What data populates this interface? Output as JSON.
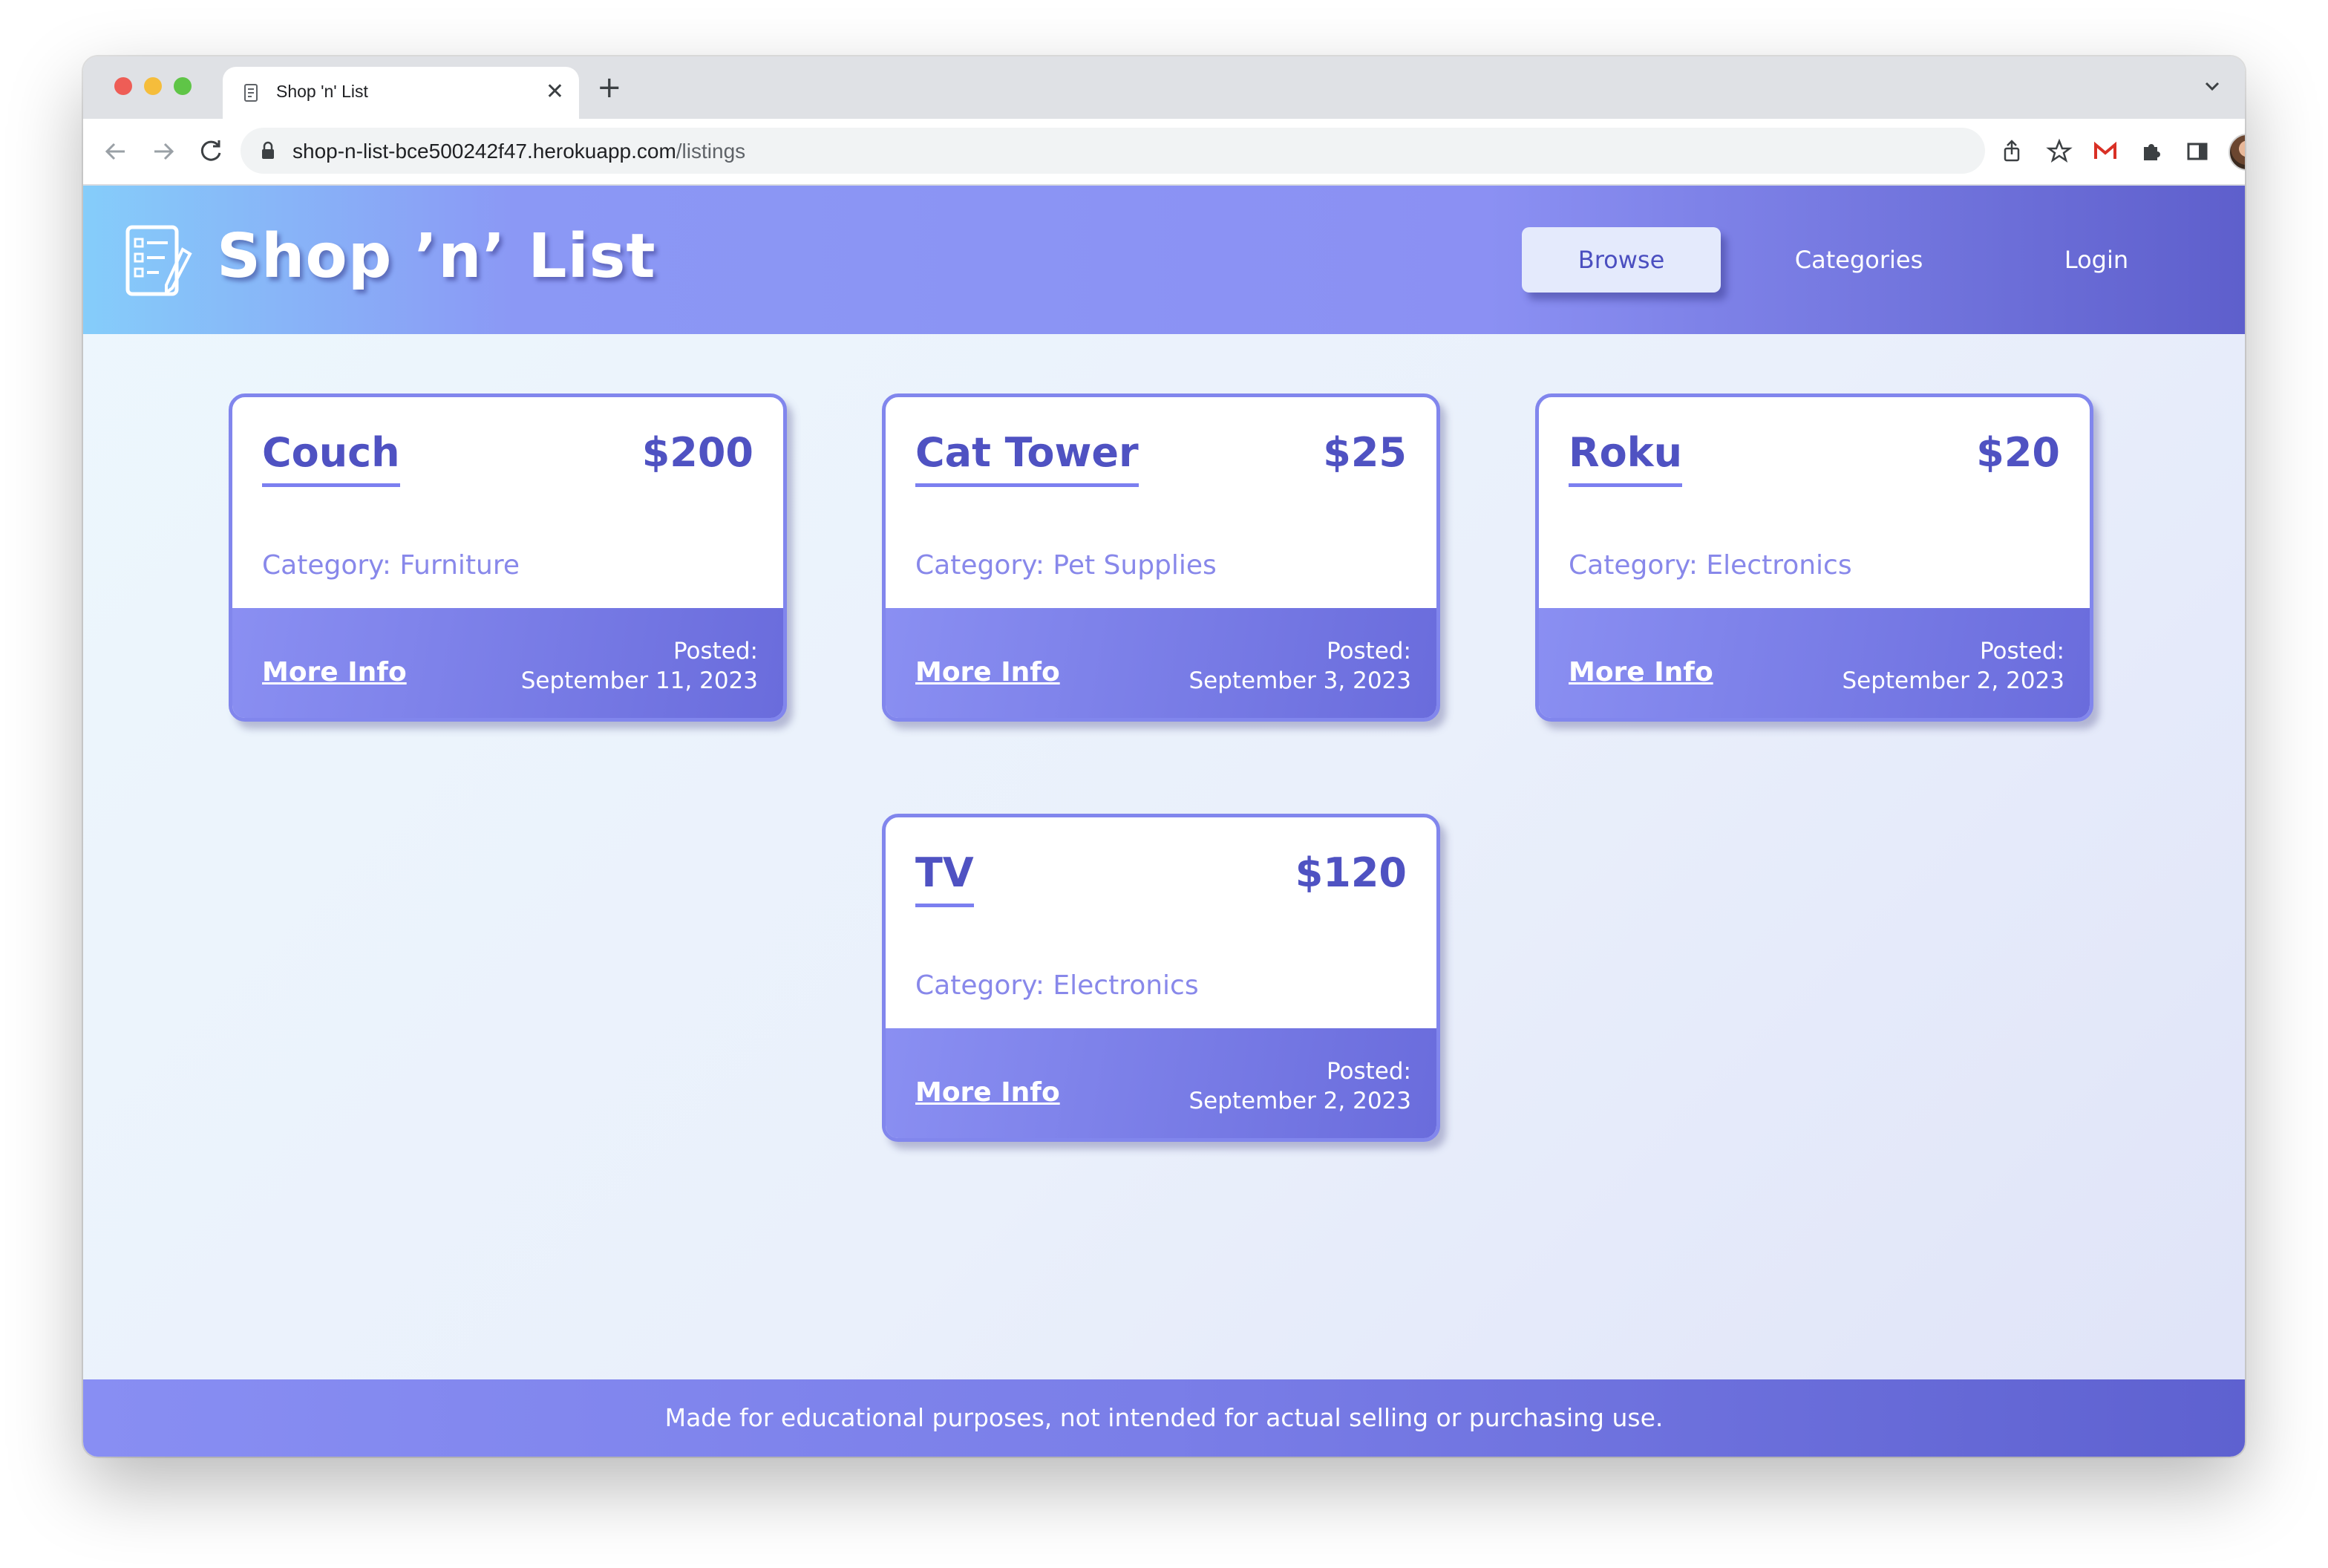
{
  "browser": {
    "tab_title": "Shop 'n' List",
    "url_host": "shop-n-list-bce500242f47.herokuapp.com",
    "url_path": "/listings"
  },
  "header": {
    "brand": "Shop ’n’ List",
    "nav": [
      {
        "label": "Browse",
        "active": true
      },
      {
        "label": "Categories",
        "active": false
      },
      {
        "label": "Login",
        "active": false
      }
    ]
  },
  "listings": [
    {
      "title": "Couch",
      "price": "$200",
      "category": "Category: Furniture",
      "more_info": "More Info",
      "posted_label": "Posted:",
      "posted_date": "September 11, 2023"
    },
    {
      "title": "Cat Tower",
      "price": "$25",
      "category": "Category: Pet Supplies",
      "more_info": "More Info",
      "posted_label": "Posted:",
      "posted_date": "September 3, 2023"
    },
    {
      "title": "Roku",
      "price": "$20",
      "category": "Category: Electronics",
      "more_info": "More Info",
      "posted_label": "Posted:",
      "posted_date": "September 2, 2023"
    },
    {
      "title": "TV",
      "price": "$120",
      "category": "Category: Electronics",
      "more_info": "More Info",
      "posted_label": "Posted:",
      "posted_date": "September 2, 2023"
    }
  ],
  "footer": {
    "text": "Made for educational purposes, not intended for actual selling or purchasing use."
  },
  "colors": {
    "accent": "#4f52c2",
    "header_start": "#85cdfa",
    "header_end": "#5e5fcc",
    "card_border": "#8186ed"
  }
}
